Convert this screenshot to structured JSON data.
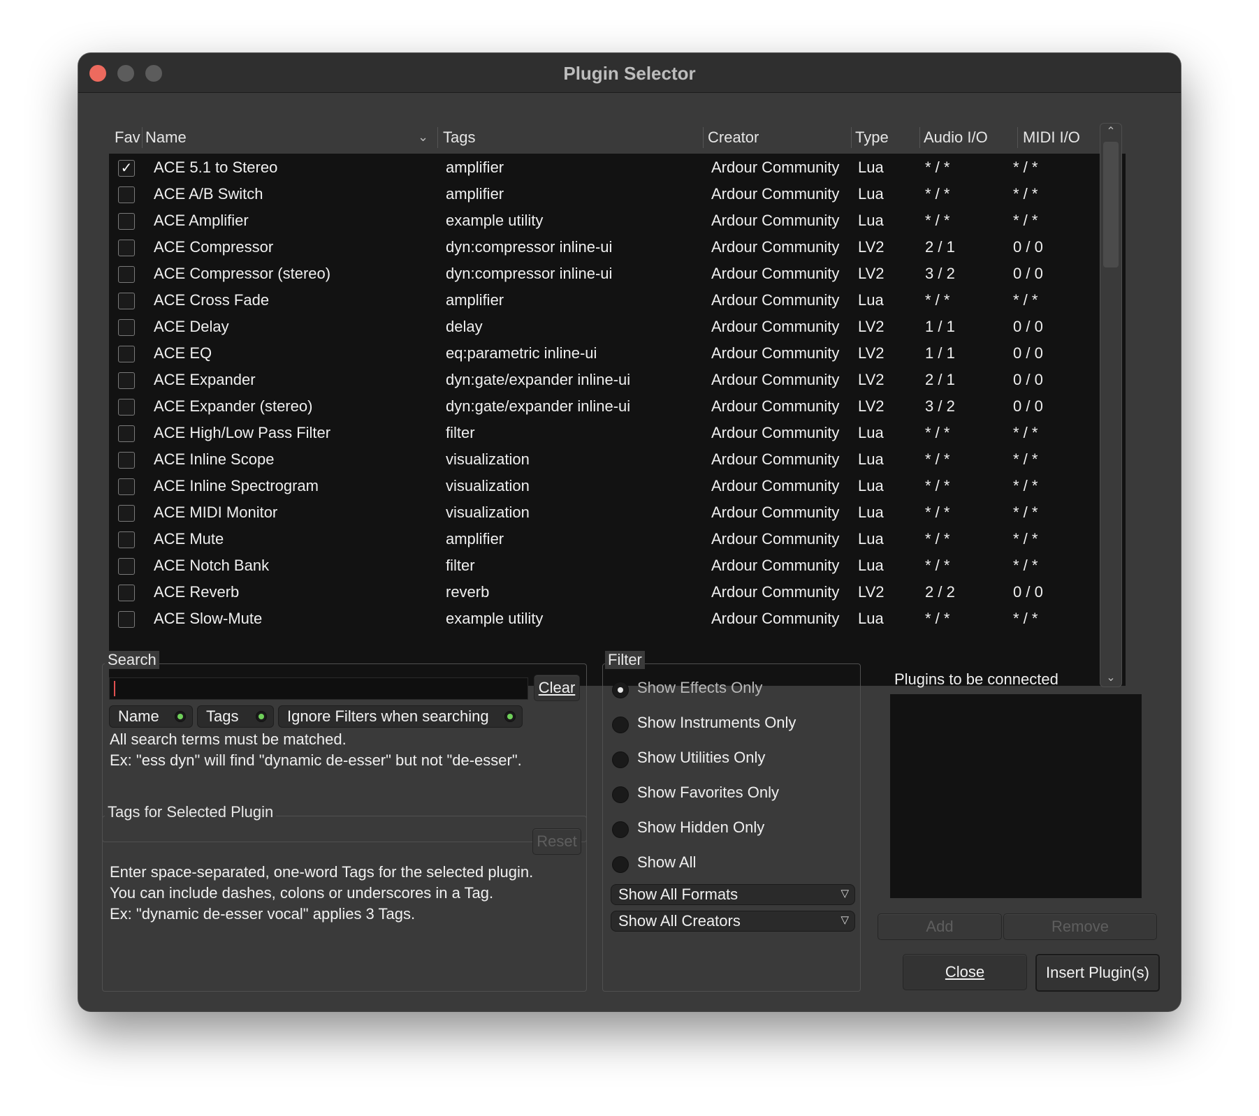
{
  "window": {
    "title": "Plugin Selector"
  },
  "table": {
    "columns": [
      "Fav",
      "Name",
      "Tags",
      "Creator",
      "Type",
      "Audio I/O",
      "MIDI I/O"
    ],
    "rows": [
      {
        "fav": true,
        "name": "ACE 5.1 to Stereo",
        "tags": "amplifier",
        "creator": "Ardour Community",
        "type": "Lua",
        "audio": "* / *",
        "midi": "* / *"
      },
      {
        "fav": false,
        "name": "ACE A/B Switch",
        "tags": "amplifier",
        "creator": "Ardour Community",
        "type": "Lua",
        "audio": "* / *",
        "midi": "* / *"
      },
      {
        "fav": false,
        "name": "ACE Amplifier",
        "tags": "example utility",
        "creator": "Ardour Community",
        "type": "Lua",
        "audio": "* / *",
        "midi": "* / *"
      },
      {
        "fav": false,
        "name": "ACE Compressor",
        "tags": "dyn:compressor inline-ui",
        "creator": "Ardour Community",
        "type": "LV2",
        "audio": "2 / 1",
        "midi": "0 / 0"
      },
      {
        "fav": false,
        "name": "ACE Compressor (stereo)",
        "tags": "dyn:compressor inline-ui",
        "creator": "Ardour Community",
        "type": "LV2",
        "audio": "3 / 2",
        "midi": "0 / 0"
      },
      {
        "fav": false,
        "name": "ACE Cross Fade",
        "tags": "amplifier",
        "creator": "Ardour Community",
        "type": "Lua",
        "audio": "* / *",
        "midi": "* / *"
      },
      {
        "fav": false,
        "name": "ACE Delay",
        "tags": "delay",
        "creator": "Ardour Community",
        "type": "LV2",
        "audio": "1 / 1",
        "midi": "0 / 0"
      },
      {
        "fav": false,
        "name": "ACE EQ",
        "tags": "eq:parametric inline-ui",
        "creator": "Ardour Community",
        "type": "LV2",
        "audio": "1 / 1",
        "midi": "0 / 0"
      },
      {
        "fav": false,
        "name": "ACE Expander",
        "tags": "dyn:gate/expander inline-ui",
        "creator": "Ardour Community",
        "type": "LV2",
        "audio": "2 / 1",
        "midi": "0 / 0"
      },
      {
        "fav": false,
        "name": "ACE Expander (stereo)",
        "tags": "dyn:gate/expander inline-ui",
        "creator": "Ardour Community",
        "type": "LV2",
        "audio": "3 / 2",
        "midi": "0 / 0"
      },
      {
        "fav": false,
        "name": "ACE High/Low Pass Filter",
        "tags": "filter",
        "creator": "Ardour Community",
        "type": "Lua",
        "audio": "* / *",
        "midi": "* / *"
      },
      {
        "fav": false,
        "name": "ACE Inline Scope",
        "tags": "visualization",
        "creator": "Ardour Community",
        "type": "Lua",
        "audio": "* / *",
        "midi": "* / *"
      },
      {
        "fav": false,
        "name": "ACE Inline Spectrogram",
        "tags": "visualization",
        "creator": "Ardour Community",
        "type": "Lua",
        "audio": "* / *",
        "midi": "* / *"
      },
      {
        "fav": false,
        "name": "ACE MIDI Monitor",
        "tags": "visualization",
        "creator": "Ardour Community",
        "type": "Lua",
        "audio": "* / *",
        "midi": "* / *"
      },
      {
        "fav": false,
        "name": "ACE Mute",
        "tags": "amplifier",
        "creator": "Ardour Community",
        "type": "Lua",
        "audio": "* / *",
        "midi": "* / *"
      },
      {
        "fav": false,
        "name": "ACE Notch Bank",
        "tags": "filter",
        "creator": "Ardour Community",
        "type": "Lua",
        "audio": "* / *",
        "midi": "* / *"
      },
      {
        "fav": false,
        "name": "ACE Reverb",
        "tags": "reverb",
        "creator": "Ardour Community",
        "type": "LV2",
        "audio": "2 / 2",
        "midi": "0 / 0"
      },
      {
        "fav": false,
        "name": "ACE Slow-Mute",
        "tags": "example utility",
        "creator": "Ardour Community",
        "type": "Lua",
        "audio": "* / *",
        "midi": "* / *"
      }
    ]
  },
  "search": {
    "frame_label": "Search",
    "value": "",
    "clear_label": "Clear",
    "toggles": [
      {
        "label": "Name",
        "on": true
      },
      {
        "label": "Tags",
        "on": true
      },
      {
        "label": "Ignore Filters when searching",
        "on": true
      }
    ],
    "help_line1": "All search terms must be matched.",
    "help_line2": "Ex: \"ess dyn\" will find \"dynamic de-esser\" but not \"de-esser\"."
  },
  "tags_panel": {
    "frame_label": "Tags for Selected Plugin",
    "reset_label": "Reset",
    "help_line1": "Enter space-separated, one-word Tags for the selected plugin.",
    "help_line2": "You can include dashes, colons or underscores in a Tag.",
    "help_line3": "Ex: \"dynamic de-esser vocal\" applies 3 Tags."
  },
  "filter": {
    "frame_label": "Filter",
    "options": [
      {
        "label": "Show Effects Only",
        "selected": true
      },
      {
        "label": "Show Instruments Only",
        "selected": false
      },
      {
        "label": "Show Utilities Only",
        "selected": false
      },
      {
        "label": "Show Favorites Only",
        "selected": false
      },
      {
        "label": "Show Hidden Only",
        "selected": false
      },
      {
        "label": "Show All",
        "selected": false
      }
    ],
    "formats_dropdown": "Show All Formats",
    "creators_dropdown": "Show All Creators"
  },
  "connect": {
    "label": "Plugins to be connected",
    "add_label": "Add",
    "remove_label": "Remove"
  },
  "footer": {
    "close_label": "Close",
    "insert_label": "Insert Plugin(s)"
  },
  "colors": {
    "window_bg": "#3a3a3a",
    "list_bg": "#121212",
    "led_green": "#6fd05a",
    "close_red": "#ed6a5e"
  }
}
